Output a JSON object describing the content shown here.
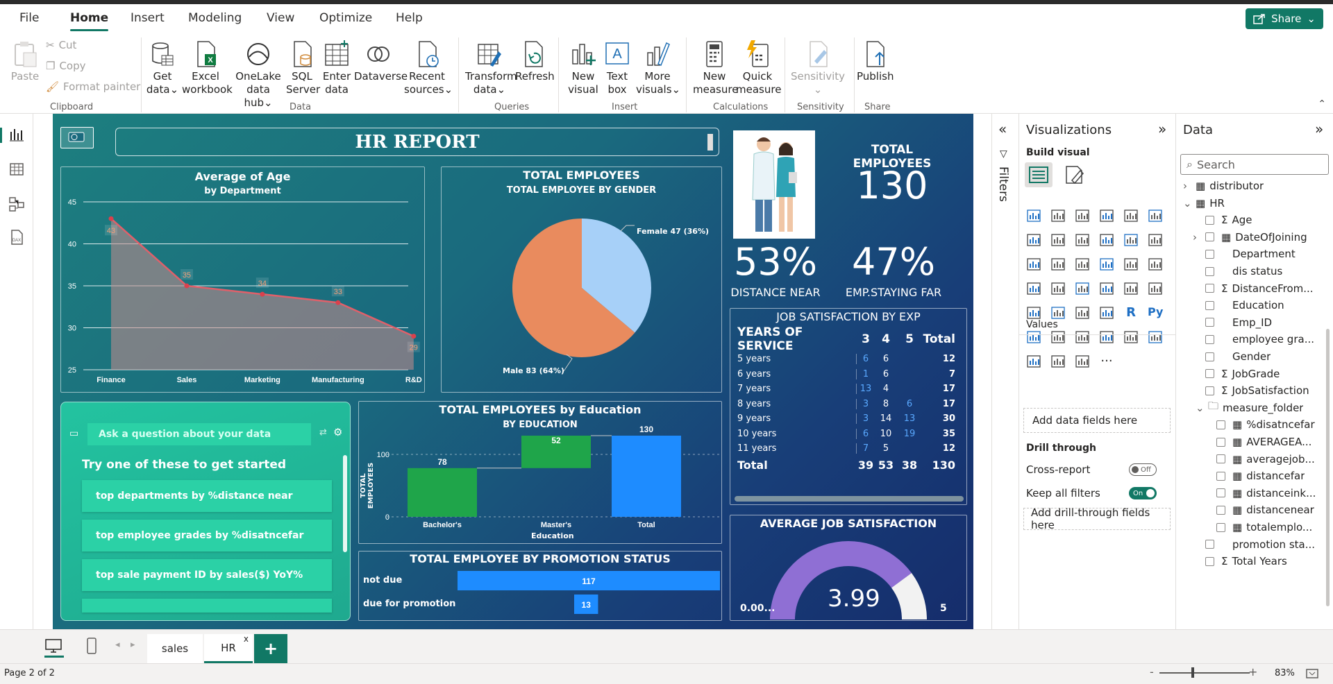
{
  "menu": {
    "file": "File",
    "home": "Home",
    "insert": "Insert",
    "modeling": "Modeling",
    "view": "View",
    "optimize": "Optimize",
    "help": "Help",
    "share": "Share"
  },
  "ribbon": {
    "clipboard": {
      "paste": "Paste",
      "cut": "Cut",
      "copy": "Copy",
      "format_painter": "Format painter",
      "label": "Clipboard"
    },
    "data": {
      "get_data": [
        "Get",
        "data"
      ],
      "excel": [
        "Excel",
        "workbook"
      ],
      "onelake": [
        "OneLake",
        "data hub"
      ],
      "sql": [
        "SQL",
        "Server"
      ],
      "enter": [
        "Enter",
        "data"
      ],
      "dataverse": "Dataverse",
      "recent": [
        "Recent",
        "sources"
      ],
      "label": "Data"
    },
    "queries": {
      "transform": [
        "Transform",
        "data"
      ],
      "refresh": "Refresh",
      "label": "Queries"
    },
    "insert": {
      "new_visual": [
        "New",
        "visual"
      ],
      "text_box": [
        "Text",
        "box"
      ],
      "more": [
        "More",
        "visuals"
      ],
      "label": "Insert"
    },
    "calc": {
      "new_measure": [
        "New",
        "measure"
      ],
      "quick": [
        "Quick",
        "measure"
      ],
      "label": "Calculations"
    },
    "sensitivity": {
      "btn": "Sensitivity",
      "label": "Sensitivity"
    },
    "share": {
      "publish": "Publish",
      "label": "Share"
    }
  },
  "report": {
    "title": "HR REPORT",
    "age_chart": {
      "title": "Average of Age",
      "subtitle": "by Department"
    },
    "gender_chart": {
      "title": "TOTAL EMPLOYEES",
      "subtitle": "TOTAL EMPLOYEE BY GENDER",
      "female_label": "Female 47 (36%)",
      "male_label": "Male 83 (64%)"
    },
    "kpi": {
      "total_label": "TOTAL EMPLOYEES",
      "total_value": "130",
      "near_value": "53%",
      "near_label": "DISTANCE NEAR",
      "far_value": "47%",
      "far_label": "EMP.STAYING FAR"
    },
    "jobsat": {
      "title": "JOB SATISFACTION BY EXP",
      "header": [
        "YEARS OF SERVICE",
        "3",
        "4",
        "5",
        "Total"
      ],
      "rows": [
        [
          "5 years",
          "6",
          "6",
          "",
          "12"
        ],
        [
          "6 years",
          "1",
          "6",
          "",
          "7"
        ],
        [
          "7 years",
          "13",
          "4",
          "",
          "17"
        ],
        [
          "8 years",
          "3",
          "8",
          "6",
          "17"
        ],
        [
          "9 years",
          "3",
          "14",
          "13",
          "30"
        ],
        [
          "10 years",
          "6",
          "10",
          "19",
          "35"
        ],
        [
          "11 years",
          "7",
          "5",
          "",
          "12"
        ]
      ],
      "total": [
        "Total",
        "39",
        "53",
        "38",
        "130"
      ]
    },
    "qa": {
      "placeholder": "Ask a question about your data",
      "heading": "Try one of these to get started",
      "s1": "top departments by %distance near",
      "s2": "top employee grades by %disatncefar",
      "s3": "top sale payment ID by sales($) YoY%"
    },
    "edu_chart": {
      "title": "TOTAL EMPLOYEES by Education",
      "subtitle": "BY EDUCATION",
      "ylabel": "TOTAL EMPLOYEES",
      "xlabel": "Education"
    },
    "promo": {
      "title": "TOTAL EMPLOYEE BY PROMOTION STATUS",
      "r1_label": "not due",
      "r1_value": "117",
      "r2_label": "due for promotion",
      "r2_value": "13"
    },
    "gauge": {
      "title": "AVERAGE JOB SATISFACTION",
      "value": "3.99",
      "min": "0.00...",
      "max": "5",
      "fraction": 0.798
    }
  },
  "chart_data": [
    {
      "type": "area",
      "title": "Average of Age",
      "subtitle": "by Department",
      "categories": [
        "Finance",
        "Sales",
        "Marketing",
        "Manufacturing",
        "R&D"
      ],
      "values": [
        43,
        35,
        34,
        33,
        29
      ],
      "ylim": [
        25,
        45
      ],
      "yticks": [
        25,
        30,
        35,
        40,
        45
      ]
    },
    {
      "type": "pie",
      "title": "TOTAL EMPLOYEE BY GENDER",
      "categories": [
        "Female",
        "Male"
      ],
      "values": [
        47,
        83
      ],
      "colors": [
        "#a7d0f8",
        "#e98b5e"
      ]
    },
    {
      "type": "bar",
      "title": "TOTAL EMPLOYEES by Education",
      "subtitle": "BY EDUCATION",
      "categories": [
        "Bachelor's",
        "Master's",
        "Total"
      ],
      "values": [
        78,
        52,
        130
      ],
      "yticks": [
        0,
        100
      ],
      "xlabel": "Education",
      "ylabel": "TOTAL EMPLOYEES"
    },
    {
      "type": "bar",
      "title": "TOTAL EMPLOYEE BY PROMOTION STATUS",
      "categories": [
        "not due",
        "due for promotion"
      ],
      "values": [
        117,
        13
      ]
    }
  ],
  "filters": {
    "label": "Filters"
  },
  "viz_pane": {
    "title": "Visualizations",
    "build": "Build visual",
    "values": "Values",
    "add_fields": "Add data fields here",
    "drill": "Drill through",
    "cross": "Cross-report",
    "cross_state": "Off",
    "keep": "Keep all filters",
    "keep_state": "On",
    "add_drill": "Add drill-through fields here"
  },
  "data_pane": {
    "title": "Data",
    "search": "Search",
    "items": [
      {
        "n": "distributor"
      },
      {
        "n": "HR"
      },
      {
        "n": "Age"
      },
      {
        "n": "DateOfJoining"
      },
      {
        "n": "Department"
      },
      {
        "n": "dis status"
      },
      {
        "n": "DistanceFrom..."
      },
      {
        "n": "Education"
      },
      {
        "n": "Emp_ID"
      },
      {
        "n": "employee gra..."
      },
      {
        "n": "Gender"
      },
      {
        "n": "JobGrade"
      },
      {
        "n": "JobSatisfaction"
      },
      {
        "n": "measure_folder"
      },
      {
        "n": "%disatncefar"
      },
      {
        "n": "AVERAGEA..."
      },
      {
        "n": "averagejob..."
      },
      {
        "n": "distancefar"
      },
      {
        "n": "distanceink..."
      },
      {
        "n": "distancenear"
      },
      {
        "n": "totalemplo..."
      },
      {
        "n": "promotion sta..."
      },
      {
        "n": "Total Years"
      }
    ]
  },
  "tabs": {
    "sales": "sales",
    "hr": "HR",
    "close": "x",
    "add": "+"
  },
  "status": {
    "page": "Page 2 of 2",
    "zoom": "83%",
    "minus": "-",
    "plus": "+"
  }
}
